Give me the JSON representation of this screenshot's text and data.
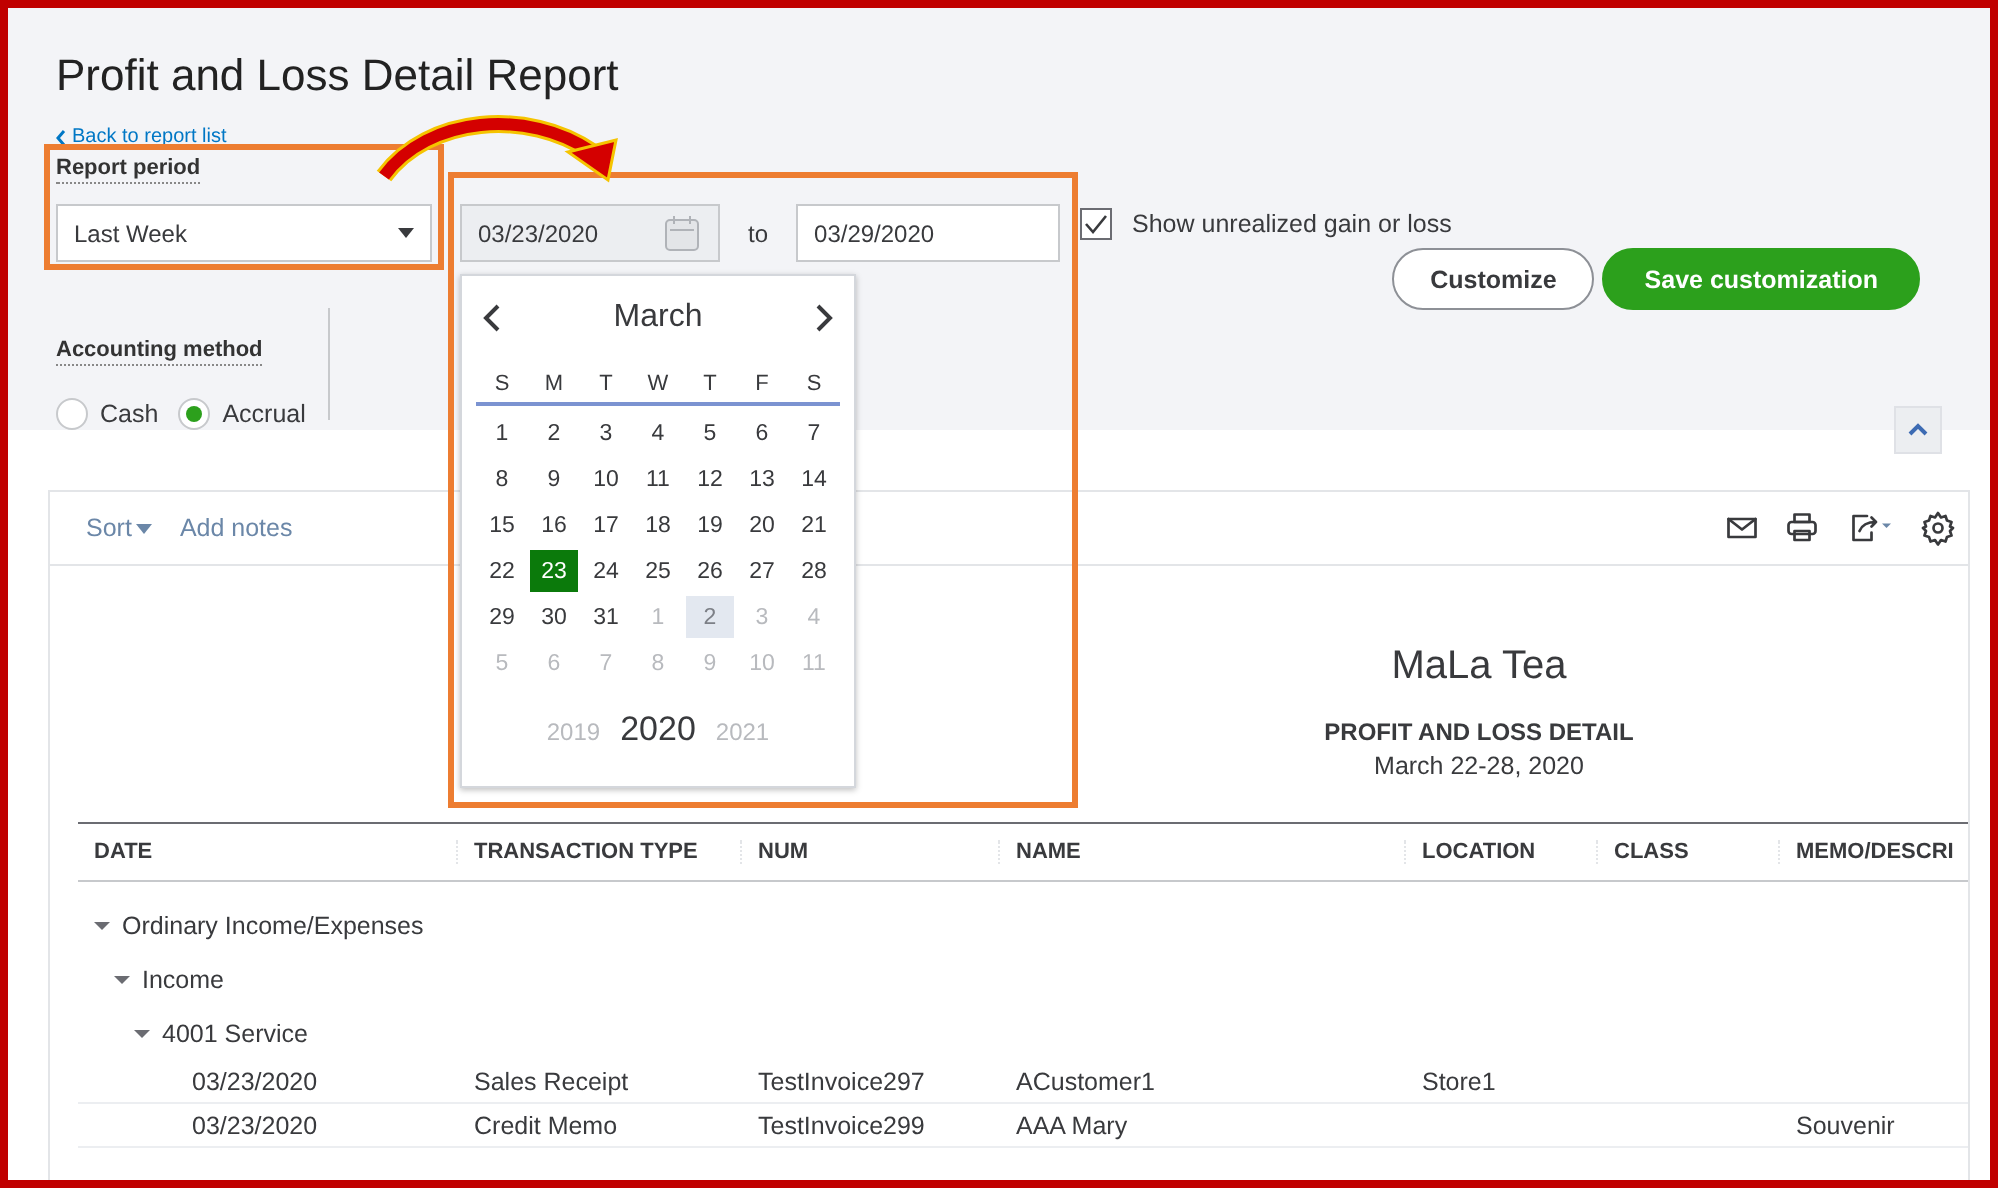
{
  "title": "Profit and Loss Detail Report",
  "back_link": "Back to report list",
  "report_period": {
    "label": "Report period",
    "value": "Last Week"
  },
  "date_from": "03/23/2020",
  "date_to_label": "to",
  "date_to": "03/29/2020",
  "unrealized": {
    "label": "Show unrealized gain or loss",
    "checked": true
  },
  "buttons": [
    {
      "label": "Customize",
      "kind": "secondary"
    },
    {
      "label": "Save customization",
      "kind": "primary"
    }
  ],
  "accounting_method": {
    "label": "Accounting method",
    "options": [
      {
        "label": "Cash",
        "selected": false
      },
      {
        "label": "Accrual",
        "selected": true
      }
    ]
  },
  "calendar": {
    "month": "March",
    "weekdays": [
      "S",
      "M",
      "T",
      "W",
      "T",
      "F",
      "S"
    ],
    "weeks": [
      [
        {
          "label": "1",
          "kind": "month",
          "selected": false
        },
        {
          "label": "2",
          "kind": "month",
          "selected": false
        },
        {
          "label": "3",
          "kind": "month",
          "selected": false
        },
        {
          "label": "4",
          "kind": "month",
          "selected": false
        },
        {
          "label": "5",
          "kind": "month",
          "selected": false
        },
        {
          "label": "6",
          "kind": "month",
          "selected": false
        },
        {
          "label": "7",
          "kind": "month",
          "selected": false
        }
      ],
      [
        {
          "label": "8",
          "kind": "month",
          "selected": false
        },
        {
          "label": "9",
          "kind": "month",
          "selected": false
        },
        {
          "label": "10",
          "kind": "month",
          "selected": false
        },
        {
          "label": "11",
          "kind": "month",
          "selected": false
        },
        {
          "label": "12",
          "kind": "month",
          "selected": false
        },
        {
          "label": "13",
          "kind": "month",
          "selected": false
        },
        {
          "label": "14",
          "kind": "month",
          "selected": false
        }
      ],
      [
        {
          "label": "15",
          "kind": "month",
          "selected": false
        },
        {
          "label": "16",
          "kind": "month",
          "selected": false
        },
        {
          "label": "17",
          "kind": "month",
          "selected": false
        },
        {
          "label": "18",
          "kind": "month",
          "selected": false
        },
        {
          "label": "19",
          "kind": "month",
          "selected": false
        },
        {
          "label": "20",
          "kind": "month",
          "selected": false
        },
        {
          "label": "21",
          "kind": "month",
          "selected": false
        }
      ],
      [
        {
          "label": "22",
          "kind": "month",
          "selected": false
        },
        {
          "label": "23",
          "kind": "month",
          "selected": true
        },
        {
          "label": "24",
          "kind": "month",
          "selected": false
        },
        {
          "label": "25",
          "kind": "month",
          "selected": false
        },
        {
          "label": "26",
          "kind": "month",
          "selected": false
        },
        {
          "label": "27",
          "kind": "month",
          "selected": false
        },
        {
          "label": "28",
          "kind": "month",
          "selected": false
        }
      ],
      [
        {
          "label": "29",
          "kind": "month",
          "selected": false
        },
        {
          "label": "30",
          "kind": "month",
          "selected": false
        },
        {
          "label": "31",
          "kind": "month",
          "selected": false
        },
        {
          "label": "1",
          "kind": "other",
          "selected": false
        },
        {
          "label": "2",
          "kind": "hover",
          "selected": false
        },
        {
          "label": "3",
          "kind": "other",
          "selected": false
        },
        {
          "label": "4",
          "kind": "other",
          "selected": false
        }
      ],
      [
        {
          "label": "5",
          "kind": "other",
          "selected": false
        },
        {
          "label": "6",
          "kind": "other",
          "selected": false
        },
        {
          "label": "7",
          "kind": "other",
          "selected": false
        },
        {
          "label": "8",
          "kind": "other",
          "selected": false
        },
        {
          "label": "9",
          "kind": "other",
          "selected": false
        },
        {
          "label": "10",
          "kind": "other",
          "selected": false
        },
        {
          "label": "11",
          "kind": "other",
          "selected": false
        }
      ]
    ],
    "years": [
      {
        "label": "2019",
        "selected": false
      },
      {
        "label": "2020",
        "selected": true
      },
      {
        "label": "2021",
        "selected": false
      }
    ]
  },
  "toolbar": {
    "sort": "Sort",
    "add_notes": "Add notes"
  },
  "report": {
    "company": "MaLa Tea",
    "name": "PROFIT AND LOSS DETAIL",
    "period": "March 22-28, 2020"
  },
  "table": {
    "columns": [
      "DATE",
      "TRANSACTION TYPE",
      "NUM",
      "NAME",
      "LOCATION",
      "CLASS",
      "MEMO/DESCRI"
    ],
    "groups": [
      {
        "label": "Ordinary Income/Expenses",
        "expanded": true,
        "children": [
          {
            "label": "Income",
            "expanded": true,
            "children": [
              {
                "label": "4001 Service",
                "expanded": true,
                "rows": [
                  [
                    "03/23/2020",
                    "Sales Receipt",
                    "TestInvoice297",
                    "ACustomer1",
                    "Store1",
                    "",
                    ""
                  ],
                  [
                    "03/23/2020",
                    "Credit Memo",
                    "TestInvoice299",
                    "AAA Mary",
                    "",
                    "",
                    "Souvenir"
                  ]
                ]
              }
            ]
          }
        ]
      }
    ]
  }
}
